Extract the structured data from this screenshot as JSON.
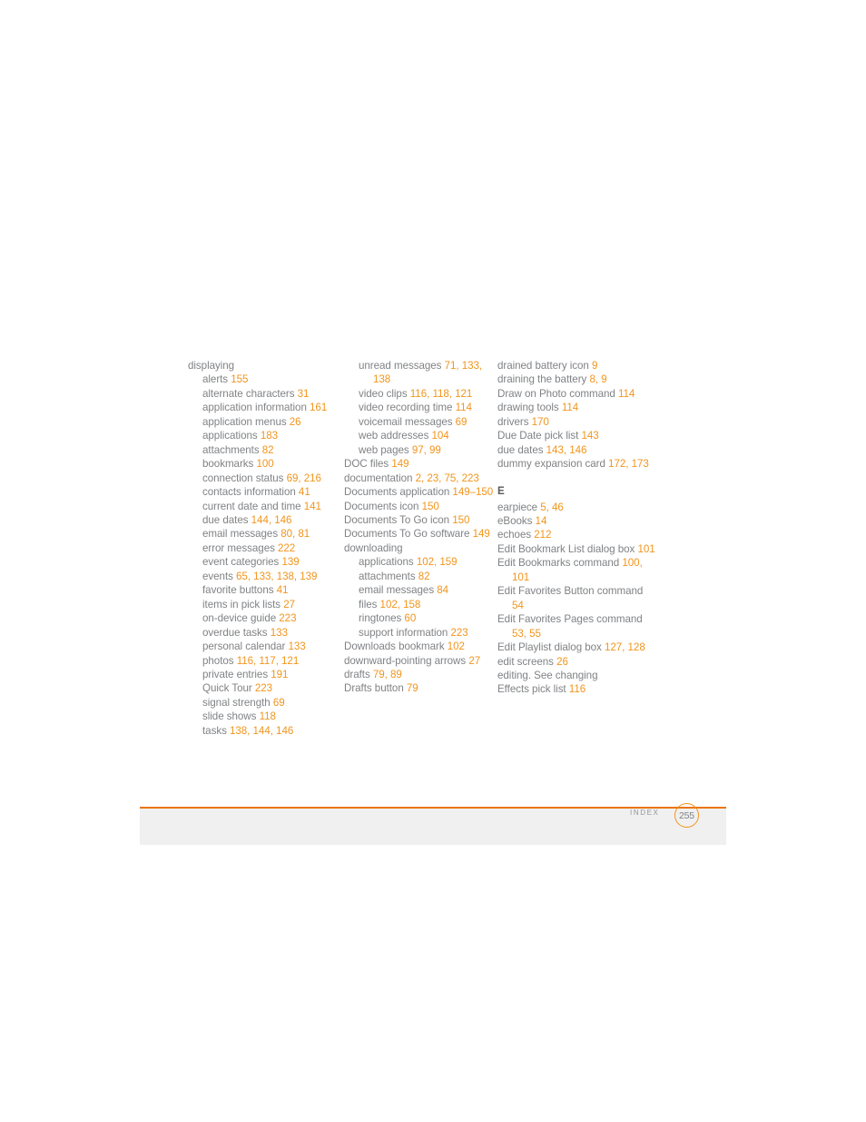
{
  "footer": {
    "section_label": "INDEX",
    "page_number": "255",
    "rule_color": "#ec7404",
    "band_color": "#f0f0f0",
    "badge_border_color": "#f2951d"
  },
  "colors": {
    "entry_text": "#808285",
    "page_ref": "#f2951d",
    "section_head": "#58595b"
  },
  "columns": [
    {
      "id": "column-1",
      "blocks": [
        {
          "type": "entries",
          "entries": [
            {
              "level": 0,
              "text": "displaying",
              "pages": ""
            },
            {
              "level": 1,
              "text": "alerts",
              "pages": "155"
            },
            {
              "level": 1,
              "text": "alternate characters",
              "pages": "31"
            },
            {
              "level": 1,
              "text": "application information",
              "pages": "161"
            },
            {
              "level": 1,
              "text": "application menus",
              "pages": "26"
            },
            {
              "level": 1,
              "text": "applications",
              "pages": "183"
            },
            {
              "level": 1,
              "text": "attachments",
              "pages": "82"
            },
            {
              "level": 1,
              "text": "bookmarks",
              "pages": "100"
            },
            {
              "level": 1,
              "text": "connection status",
              "pages": "69, 216"
            },
            {
              "level": 1,
              "text": "contacts information",
              "pages": "41"
            },
            {
              "level": 1,
              "text": "current date and time",
              "pages": "141"
            },
            {
              "level": 1,
              "text": "due dates",
              "pages": "144, 146"
            },
            {
              "level": 1,
              "text": "email messages",
              "pages": "80, 81"
            },
            {
              "level": 1,
              "text": "error messages",
              "pages": "222"
            },
            {
              "level": 1,
              "text": "event categories",
              "pages": "139"
            },
            {
              "level": 1,
              "text": "events",
              "pages": "65, 133, 138, 139"
            },
            {
              "level": 1,
              "text": "favorite buttons",
              "pages": "41"
            },
            {
              "level": 1,
              "text": "items in pick lists",
              "pages": "27"
            },
            {
              "level": 1,
              "text": "on-device guide",
              "pages": "223"
            },
            {
              "level": 1,
              "text": "overdue tasks",
              "pages": "133"
            },
            {
              "level": 1,
              "text": "personal calendar",
              "pages": "133"
            },
            {
              "level": 1,
              "text": "photos",
              "pages": "116, 117, 121"
            },
            {
              "level": 1,
              "text": "private entries",
              "pages": "191"
            },
            {
              "level": 1,
              "text": "Quick Tour",
              "pages": "223"
            },
            {
              "level": 1,
              "text": "signal strength",
              "pages": "69"
            },
            {
              "level": 1,
              "text": "slide shows",
              "pages": "118"
            },
            {
              "level": 1,
              "text": "tasks",
              "pages": "138, 144, 146"
            }
          ]
        }
      ]
    },
    {
      "id": "column-2",
      "blocks": [
        {
          "type": "entries",
          "entries": [
            {
              "level": 1,
              "text": "unread messages",
              "pages": "71, 133, 138"
            },
            {
              "level": 1,
              "text": "video clips",
              "pages": "116, 118, 121"
            },
            {
              "level": 1,
              "text": "video recording time",
              "pages": "114"
            },
            {
              "level": 1,
              "text": "voicemail messages",
              "pages": "69"
            },
            {
              "level": 1,
              "text": "web addresses",
              "pages": "104"
            },
            {
              "level": 1,
              "text": "web pages",
              "pages": "97, 99"
            },
            {
              "level": 0,
              "text": "DOC files",
              "pages": "149"
            },
            {
              "level": 0,
              "text": "documentation",
              "pages": "2, 23, 75, 223"
            },
            {
              "level": 0,
              "text": "Documents application",
              "pages": "149–150"
            },
            {
              "level": 0,
              "text": "Documents icon",
              "pages": "150"
            },
            {
              "level": 0,
              "text": "Documents To Go icon",
              "pages": "150"
            },
            {
              "level": 0,
              "text": "Documents To Go software",
              "pages": "149"
            },
            {
              "level": 0,
              "text": "downloading",
              "pages": ""
            },
            {
              "level": 1,
              "text": "applications",
              "pages": "102, 159"
            },
            {
              "level": 1,
              "text": "attachments",
              "pages": "82"
            },
            {
              "level": 1,
              "text": "email messages",
              "pages": "84"
            },
            {
              "level": 1,
              "text": "files",
              "pages": "102, 158"
            },
            {
              "level": 1,
              "text": "ringtones",
              "pages": "60"
            },
            {
              "level": 1,
              "text": "support information",
              "pages": "223"
            },
            {
              "level": 0,
              "text": "Downloads bookmark",
              "pages": "102"
            },
            {
              "level": 0,
              "text": "downward-pointing arrows",
              "pages": "27"
            },
            {
              "level": 0,
              "text": "drafts",
              "pages": "79, 89"
            },
            {
              "level": 0,
              "text": "Drafts button",
              "pages": "79"
            }
          ]
        }
      ]
    },
    {
      "id": "column-3",
      "blocks": [
        {
          "type": "entries",
          "entries": [
            {
              "level": 0,
              "text": "drained battery icon",
              "pages": "9"
            },
            {
              "level": 0,
              "text": "draining the battery",
              "pages": "8, 9"
            },
            {
              "level": 0,
              "text": "Draw on Photo command",
              "pages": "114"
            },
            {
              "level": 0,
              "text": "drawing tools",
              "pages": "114"
            },
            {
              "level": 0,
              "text": "drivers",
              "pages": "170"
            },
            {
              "level": 0,
              "text": "Due Date pick list",
              "pages": "143"
            },
            {
              "level": 0,
              "text": "due dates",
              "pages": "143, 146"
            },
            {
              "level": 0,
              "text": "dummy expansion card",
              "pages": "172, 173"
            }
          ]
        },
        {
          "type": "heading",
          "label": "E"
        },
        {
          "type": "entries",
          "entries": [
            {
              "level": 0,
              "text": "earpiece",
              "pages": "5, 46"
            },
            {
              "level": 0,
              "text": "eBooks",
              "pages": "14"
            },
            {
              "level": 0,
              "text": "echoes",
              "pages": "212"
            },
            {
              "level": 0,
              "text": "Edit Bookmark List dialog box",
              "pages": "101"
            },
            {
              "level": 0,
              "text": "Edit Bookmarks command",
              "pages": "100, 101"
            },
            {
              "level": 0,
              "text": "Edit Favorites Button command",
              "pages": "54"
            },
            {
              "level": 0,
              "text": "Edit Favorites Pages command",
              "pages": "53, 55"
            },
            {
              "level": 0,
              "text": "Edit Playlist dialog box",
              "pages": "127, 128"
            },
            {
              "level": 0,
              "text": "edit screens",
              "pages": "26"
            },
            {
              "level": 0,
              "text": "editing. See changing",
              "pages": ""
            },
            {
              "level": 0,
              "text": "Effects pick list",
              "pages": "116"
            }
          ]
        }
      ]
    }
  ]
}
